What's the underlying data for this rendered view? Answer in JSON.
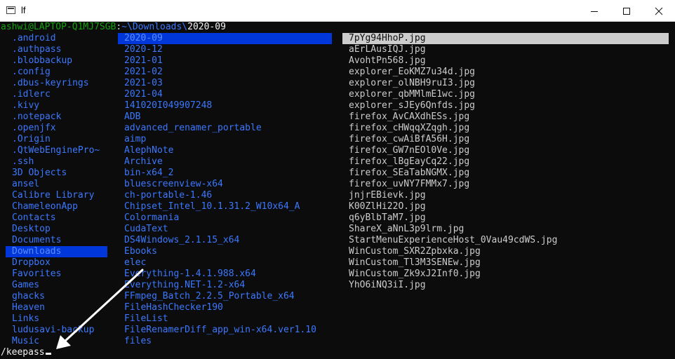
{
  "window": {
    "title": "lf",
    "icons": {
      "app": "console-window-icon",
      "minimize": "minimize-icon",
      "maximize": "maximize-icon",
      "close": "close-icon"
    }
  },
  "prompt": {
    "user_host": "ashwi@LAPTOP-Q1MJ7SGB",
    "separator": ":",
    "path": "~\\Downloads\\",
    "current": "2020-09"
  },
  "columns": {
    "parent": [
      ".android",
      ".authpass",
      ".blobbackup",
      ".config",
      ".dbus-keyrings",
      ".idlerc",
      ".kivy",
      ".notepack",
      ".openjfx",
      ".Origin",
      ".QtWebEnginePro~",
      ".ssh",
      "3D Objects",
      "ansel",
      "Calibre Library",
      "ChameleonApp",
      "Contacts",
      "Desktop",
      "Documents",
      "Downloads",
      "Dropbox",
      "Favorites",
      "Games",
      "ghacks",
      "Heaven",
      "Links",
      "ludusavi-backup",
      "Music"
    ],
    "parent_selected_index": 19,
    "current": [
      "2020-09",
      "2020-12",
      "2021-01",
      "2021-02",
      "2021-03",
      "2021-04",
      "141020I049907248",
      "ADB",
      "advanced_renamer_portable",
      "aimp",
      "AlephNote",
      "Archive",
      "bin-x64_2",
      "bluescreenview-x64",
      "ch-portable-1.46",
      "Chipset_Intel_10.1.31.2_W10x64_A",
      "Colormania",
      "CudaText",
      "DS4Windows_2.1.15_x64",
      "Ebooks",
      "elec",
      "Everything-1.4.1.988.x64",
      "Everything.NET-1.2-x64",
      "FFmpeg_Batch_2.2.5_Portable_x64",
      "FileHashChecker190",
      "FileList",
      "FileRenamerDiff_app_win-x64.ver1.10",
      "files"
    ],
    "current_selected_index": 0,
    "preview": [
      "7pYg94HhoP.jpg",
      "aErLAusIQJ.jpg",
      "AvohtPn568.jpg",
      "explorer_EoKMZ7u34d.jpg",
      "explorer_olNBH9ruI3.jpg",
      "explorer_qbMMlmE1wc.jpg",
      "explorer_sJEy6Qnfds.jpg",
      "firefox_AvCAXdhESs.jpg",
      "firefox_cHWqqXZqgh.jpg",
      "firefox_cwAiBfA56H.jpg",
      "firefox_GW7nEOl0Ve.jpg",
      "firefox_lBgEayCq22.jpg",
      "firefox_SEaTabNGMX.jpg",
      "firefox_uvNY7FMMx7.jpg",
      "jnjrEBievk.jpg",
      "K00ZlHi22O.jpg",
      "q6yBlbTaM7.jpg",
      "ShareX_aNnL3p9lrm.jpg",
      "StartMenuExperienceHost_0Vau49cdWS.jpg",
      "WinCustom_SXR2Zpbxka.jpg",
      "WinCustom_Tl3M3SENEw.jpg",
      "WinCustom_Zk9xJ2Inf0.jpg",
      "YhO6iNQ3iI.jpg"
    ],
    "preview_selected_index": 0
  },
  "command_line": "/keepass",
  "colors": {
    "background": "#0c0c0c",
    "directory": "#3b78ff",
    "prompt_user": "#13a10e",
    "selection": "#0037da",
    "preview_selection": "#cccccc",
    "annotation_arrow": "#ffffff"
  }
}
